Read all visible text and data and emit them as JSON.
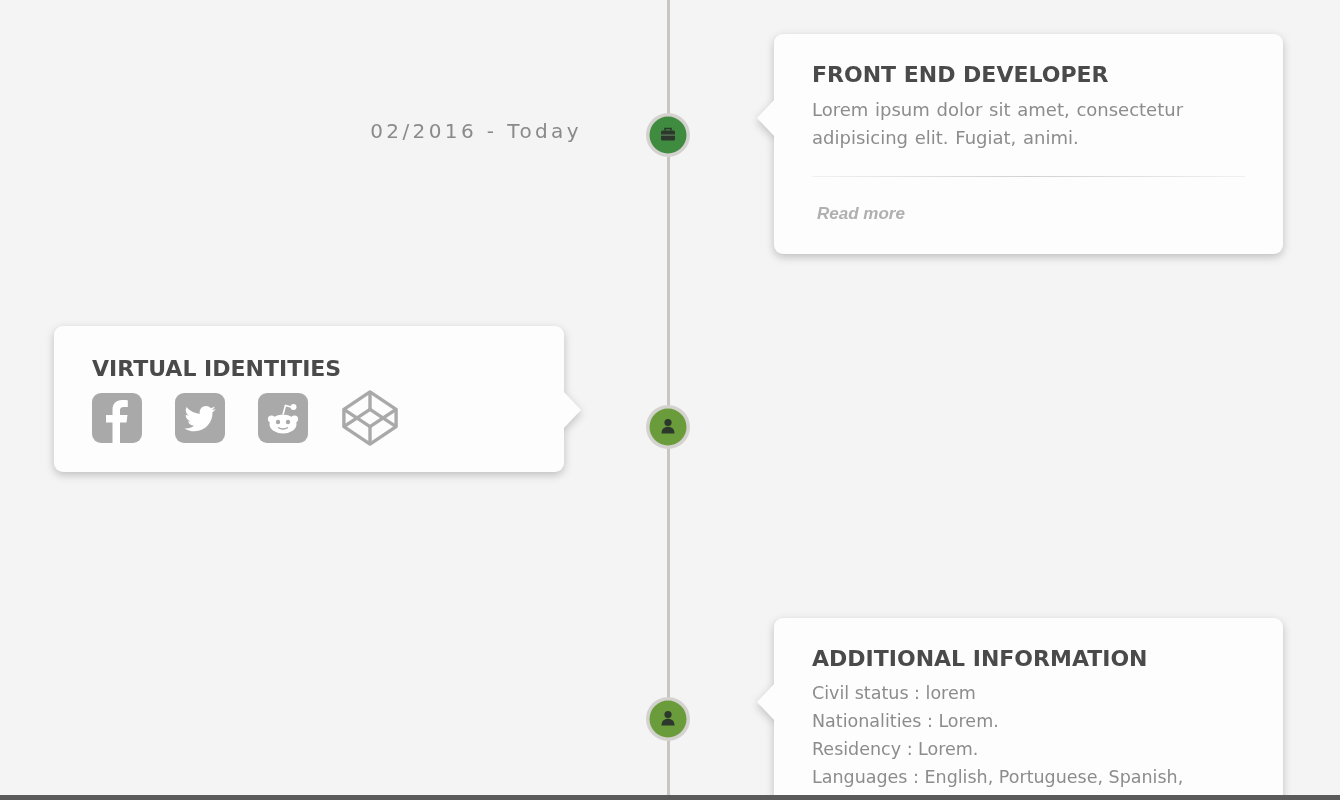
{
  "timeline": {
    "entries": [
      {
        "kind": "experience",
        "date": "02/2016 - Today",
        "node": {
          "color": "#3f8b3f"
        },
        "card": {
          "title": "FRONT END DEVELOPER",
          "body": "Lorem ipsum dolor sit amet, consectetur adipisicing elit. Fugiat, animi.",
          "link": "Read more"
        }
      },
      {
        "kind": "social",
        "node": {
          "color": "#6b9c3b"
        },
        "card": {
          "title": "VIRTUAL IDENTITIES",
          "icons": [
            {
              "kind": "facebook"
            },
            {
              "kind": "twitter"
            },
            {
              "kind": "reddit"
            },
            {
              "kind": "codepen"
            }
          ]
        }
      },
      {
        "kind": "info",
        "node": {
          "color": "#6b9c3b"
        },
        "card": {
          "title": "ADDITIONAL INFORMATION",
          "lines": [
            "Civil status : lorem",
            "Nationalities : Lorem.",
            "Residency : Lorem.",
            "Languages : English, Portuguese, Spanish,"
          ]
        }
      }
    ]
  }
}
